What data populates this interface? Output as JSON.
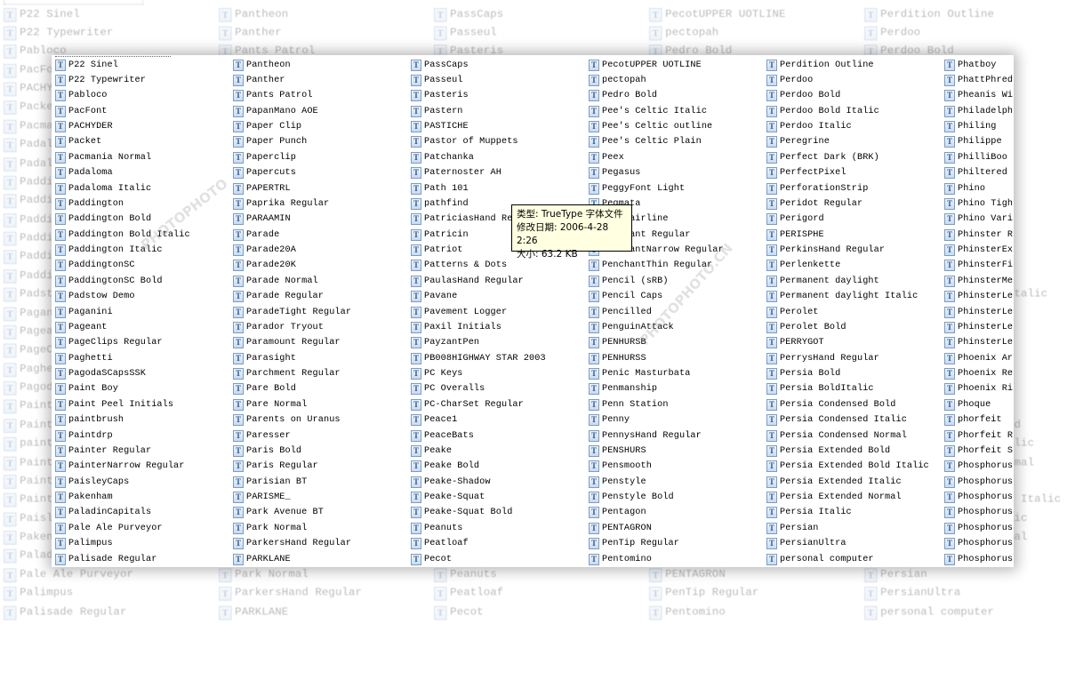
{
  "columns": [
    [
      "P22 Sinel",
      "P22 Typewriter",
      "Pabloco",
      "PacFont",
      "PACHYDER",
      "Packet",
      "Pacmania Normal",
      "Padaloma",
      "Padaloma Italic",
      "Paddington",
      "Paddington Bold",
      "Paddington Bold Italic",
      "Paddington Italic",
      "PaddingtonSC",
      "PaddingtonSC Bold",
      "Padstow Demo",
      "Paganini",
      "Pageant",
      "PageClips Regular",
      "Paghetti",
      "PagodaSCapsSSK",
      "Paint Boy",
      "Paint Peel Initials",
      "paintbrush",
      "Paintdrp",
      "Painter Regular",
      "PainterNarrow Regular",
      "PaisleyCaps",
      "Pakenham",
      "PaladinCapitals",
      "Pale Ale Purveyor",
      "Palimpus",
      "Palisade Regular"
    ],
    [
      "Pantheon",
      "Panther",
      "Pants Patrol",
      "PapanMano AOE",
      "Paper Clip",
      "Paper Punch",
      "Paperclip",
      "Papercuts",
      "PAPERTRL",
      "Paprika Regular",
      "PARAAMIN",
      "Parade",
      "Parade20A",
      "Parade20K",
      "Parade Normal",
      "Parade Regular",
      "ParadeTight Regular",
      "Parador Tryout",
      "Paramount Regular",
      "Parasight",
      "Parchment Regular",
      "Pare Bold",
      "Pare Normal",
      "Parents on Uranus",
      "Paresser",
      "Paris Bold",
      "Paris Regular",
      "Parisian BT",
      "PARISME_",
      "Park Avenue BT",
      "Park Normal",
      "ParkersHand Regular",
      "PARKLANE"
    ],
    [
      "PassCaps",
      "Passeul",
      "Pasteris",
      "Pastern",
      "PASTICHE",
      "Pastor of Muppets",
      "Patchanka",
      "Paternoster AH",
      "Path 101",
      "pathfind",
      "PatriciasHand Regular",
      "Patricin",
      "Patriot",
      "Patterns & Dots",
      "PaulasHand Regular",
      "Pavane",
      "Pavement Logger",
      "Paxil Initials",
      "PayzantPen",
      "PB008HIGHWAY STAR 2003",
      "PC Keys",
      "PC Overalls",
      "PC-CharSet Regular",
      "Peace1",
      "PeaceBats",
      "Peake",
      "Peake Bold",
      "Peake-Shadow",
      "Peake-Squat",
      "Peake-Squat Bold",
      "Peanuts",
      "Peatloaf",
      "Pecot"
    ],
    [
      "PecotUPPER UOTLINE",
      "pectopah",
      "Pedro Bold",
      "Pee's Celtic Italic",
      "Pee's Celtic outline",
      "Pee's Celtic Plain",
      "Peex",
      "Pegasus",
      "PeggyFont Light",
      "Pegmata",
      "Pen Hairline",
      "Penchant Regular",
      "PenchantNarrow Regular",
      "PenchantThin Regular",
      "Pencil (sRB)",
      "Pencil Caps",
      "Pencilled",
      "PenguinAttack",
      "PENHURSB",
      "PENHURSS",
      "Penic Masturbata",
      "Penmanship",
      "Penn Station",
      "Penny",
      "PennysHand Regular",
      "PENSHURS",
      "Pensmooth",
      "Penstyle",
      "Penstyle Bold",
      "Pentagon",
      "PENTAGRON",
      "PenTip Regular",
      "Pentomino"
    ],
    [
      "Perdition Outline",
      "Perdoo",
      "Perdoo Bold",
      "Perdoo Bold Italic",
      "Perdoo Italic",
      "Peregrine",
      "Perfect Dark (BRK)",
      "PerfectPixel",
      "PerforationStrip",
      "Peridot Regular",
      "Perigord",
      "PERISPHE",
      "PerkinsHand Regular",
      "Perlenkette",
      "Permanent daylight",
      "Permanent daylight Italic",
      "Perolet",
      "Perolet Bold",
      "PERRYGOT",
      "PerrysHand Regular",
      "Persia Bold",
      "Persia BoldItalic",
      "Persia Condensed Bold",
      "Persia Condensed Italic",
      "Persia Condensed Normal",
      "Persia Extended Bold",
      "Persia Extended Bold Italic",
      "Persia Extended Italic",
      "Persia Extended Normal",
      "Persia Italic",
      "Persian",
      "PersianUltra",
      "personal computer"
    ],
    [
      "Phatboy",
      "PhattPhred",
      "Pheanis Wi",
      "Philadelph",
      "Philing",
      "Philippe",
      "PhilliBoo",
      "Philtered",
      "Phino",
      "Phino Tigh",
      "Phino Vari",
      "Phinster R",
      "PhinsterEx",
      "PhinsterFi",
      "PhinsterMe",
      "PhinsterLe",
      "PhinsterLe",
      "PhinsterLe",
      "PhinsterLe",
      "Phoenix Ar",
      "Phoenix Re",
      "Phoenix Ri",
      "Phoque",
      "phorfeit",
      "Phorfeit R",
      "Phorfeit S",
      "Phosphorus",
      "Phosphorus",
      "Phosphorus",
      "Phosphorus",
      "Phosphorus",
      "Phosphorus",
      "Phosphorus"
    ]
  ],
  "tooltip": {
    "type": "类型: TrueType 字体文件",
    "modified": "修改日期: 2006-4-28 2:26",
    "size": "大小: 63.2 KB"
  },
  "icons": {
    "font_file": "truetype-font-icon"
  },
  "watermark": "PHOTOPHOTO.CN",
  "colors": {
    "tooltip_bg": "#ffffe1",
    "icon_border": "#7b9cc4"
  }
}
